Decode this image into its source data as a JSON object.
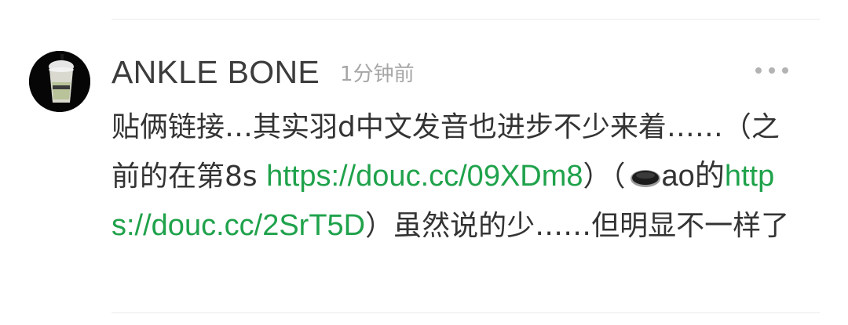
{
  "comment": {
    "username": "ANKLE BONE",
    "time": "1分钟前",
    "more_icon": "ellipsis-icon",
    "text_1": "贴俩链接…其实羽d中文发音也进步不少来着……",
    "text_2": "（之前的在第8s ",
    "link_1": "https://douc.cc/09XDm8",
    "text_3": "）（",
    "emoji": "hole-emoji-icon",
    "text_4": "ao的",
    "link_2": "https://douc.cc/2SrT5D",
    "text_5": "）虽然说的少……但明显不一样了"
  },
  "colors": {
    "link": "#1fa24b",
    "text": "#333333",
    "time": "#a6a6a6",
    "divider": "#ececec"
  }
}
